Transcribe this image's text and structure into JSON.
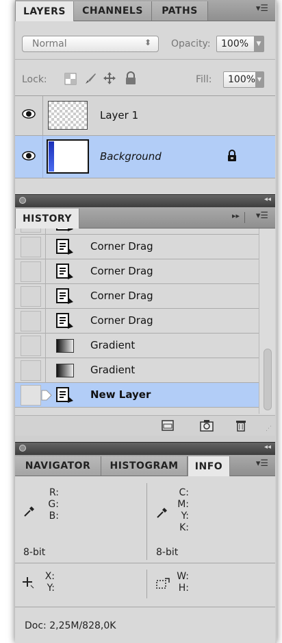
{
  "layers_panel": {
    "tabs": [
      {
        "label": "LAYERS",
        "active": true
      },
      {
        "label": "CHANNELS",
        "active": false
      },
      {
        "label": "PATHS",
        "active": false
      }
    ],
    "blend_mode": "Normal",
    "opacity_label": "Opacity:",
    "opacity_value": "100%",
    "lock_label": "Lock:",
    "fill_label": "Fill:",
    "fill_value": "100%",
    "layers": [
      {
        "name": "Layer 1",
        "visible": true,
        "selected": false,
        "locked": false
      },
      {
        "name": "Background",
        "visible": true,
        "selected": true,
        "locked": true
      }
    ]
  },
  "history_panel": {
    "title": "HISTORY",
    "items": [
      {
        "label": "Corner Drag",
        "icon": "step-icon"
      },
      {
        "label": "Corner Drag",
        "icon": "step-icon"
      },
      {
        "label": "Corner Drag",
        "icon": "step-icon"
      },
      {
        "label": "Corner Drag",
        "icon": "step-icon"
      },
      {
        "label": "Gradient",
        "icon": "gradient-icon"
      },
      {
        "label": "Gradient",
        "icon": "gradient-icon"
      },
      {
        "label": "New Layer",
        "icon": "step-icon",
        "selected": true
      }
    ]
  },
  "info_panel": {
    "tabs": [
      {
        "label": "NAVIGATOR",
        "active": false
      },
      {
        "label": "HISTOGRAM",
        "active": false
      },
      {
        "label": "INFO",
        "active": true
      }
    ],
    "rgb_labels": [
      "R:",
      "G:",
      "B:"
    ],
    "cmyk_labels": [
      "C:",
      "M:",
      "Y:",
      "K:"
    ],
    "bit_depth_left": "8-bit",
    "bit_depth_right": "8-bit",
    "xy_labels": [
      "X:",
      "Y:"
    ],
    "wh_labels": [
      "W:",
      "H:"
    ],
    "doc_size": "Doc: 2,25M/828,0K"
  },
  "colors": {
    "selection": "#b2cdf7",
    "panel_bg": "#d9d9d9"
  }
}
